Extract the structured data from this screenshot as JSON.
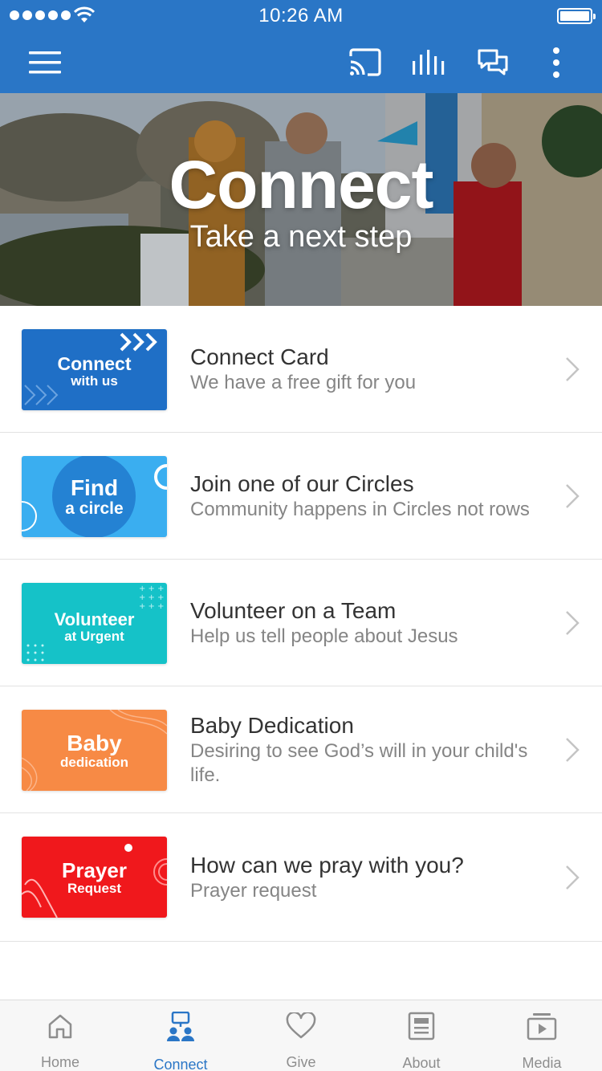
{
  "status_bar": {
    "time": "10:26 AM"
  },
  "top_bar": {
    "icons": [
      "menu-icon",
      "cast-icon",
      "audio-levels-icon",
      "chat-icon",
      "more-vertical-icon"
    ]
  },
  "hero": {
    "title": "Connect",
    "subtitle": "Take a next step"
  },
  "list": {
    "items": [
      {
        "thumb_big": "Connect",
        "thumb_small": "with us",
        "thumb_color": "#1f6fc6",
        "title": "Connect Card",
        "subtitle": "We have a free gift for you"
      },
      {
        "thumb_big": "Find",
        "thumb_small": "a circle",
        "thumb_color": "#3aaef0",
        "title": "Join one of our Circles",
        "subtitle": "Community happens in Circles not rows"
      },
      {
        "thumb_big": "Volunteer",
        "thumb_small": "at Urgent",
        "thumb_color": "#15c2c8",
        "title": "Volunteer on a Team",
        "subtitle": "Help us tell people about Jesus"
      },
      {
        "thumb_big": "Baby",
        "thumb_small": "dedication",
        "thumb_color": "#f78a45",
        "title": "Baby Dedication",
        "subtitle": "Desiring to see God’s will in your child's life."
      },
      {
        "thumb_big": "Prayer",
        "thumb_small": "Request",
        "thumb_color": "#f0181c",
        "title": "How can we pray with you?",
        "subtitle": "Prayer request"
      }
    ]
  },
  "tab_bar": {
    "active": "Connect",
    "active_color": "#2a76c6",
    "tabs": [
      {
        "label": "Home",
        "icon": "home-icon"
      },
      {
        "label": "Connect",
        "icon": "connect-people-icon"
      },
      {
        "label": "Give",
        "icon": "heart-icon"
      },
      {
        "label": "About",
        "icon": "document-icon"
      },
      {
        "label": "Media",
        "icon": "media-play-icon"
      }
    ]
  },
  "colors": {
    "brand": "#2a76c6"
  }
}
